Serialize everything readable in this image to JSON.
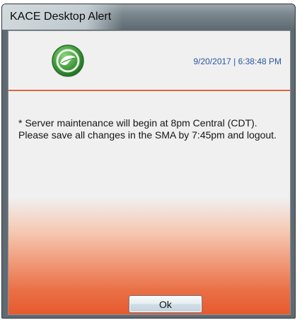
{
  "window": {
    "title": "KACE Desktop Alert"
  },
  "alert": {
    "timestamp": "9/20/2017 | 6:38:48 PM",
    "message": "* Server maintenance will begin at 8pm Central (CDT).  Please save all changes in the SMA by 7:45pm and logout.",
    "ok_label": "Ok"
  },
  "icons": {
    "logo": "kace-leaf-logo-icon"
  },
  "colors": {
    "timestamp": "#2a56a0",
    "divider": "#e06540",
    "gradient_bottom": "#e65a2e",
    "logo_green": "#3f9a3a"
  }
}
